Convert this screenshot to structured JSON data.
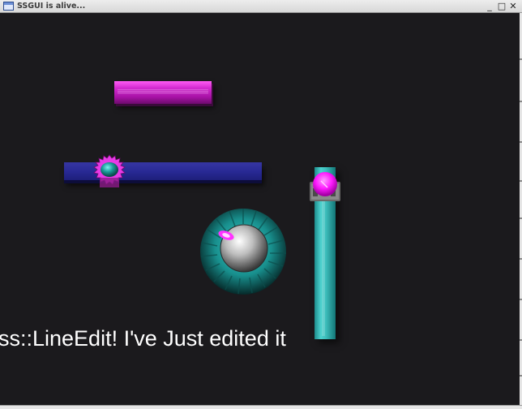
{
  "window": {
    "title": "SSGUI is alive...",
    "buttons": {
      "minimize": "_",
      "maximize": "□",
      "close": "✕"
    },
    "icon": "window-app-icon"
  },
  "widgets": {
    "pink_slab": {
      "color": "#c41ec4",
      "icon": "pink-bar"
    },
    "horizontal_slider": {
      "track_color": "#2b2c99",
      "knob_color": "#1fb3b3",
      "gear_color": "#e83ae6",
      "value": 0.22
    },
    "vertical_slider": {
      "track_color": "#3cbcba",
      "knob_color": "#ff2bff",
      "value": 1.0
    },
    "dial": {
      "body_color": "#1a9a9a",
      "hub_color": "#bdbdbd",
      "marker_color": "#ff33ff"
    },
    "line_edit": {
      "value": "ss::LineEdit! I've Just edited it"
    }
  }
}
